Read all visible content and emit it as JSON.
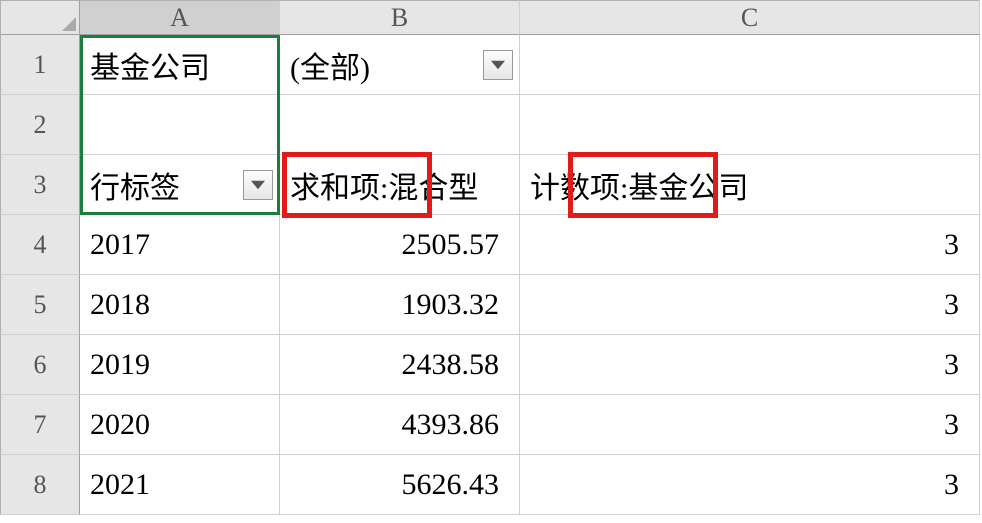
{
  "columns": [
    "A",
    "B",
    "C"
  ],
  "rows": [
    "1",
    "2",
    "3",
    "4",
    "5",
    "6",
    "7",
    "8"
  ],
  "a1_label": "基金公司",
  "b1_filter_value": "(全部)",
  "a3_label": "行标签",
  "b3_label": "求和项:混合型",
  "c3_label": "计数项:基金公司",
  "data_rows": [
    {
      "year": "2017",
      "sum": "2505.57",
      "count": "3"
    },
    {
      "year": "2018",
      "sum": "1903.32",
      "count": "3"
    },
    {
      "year": "2019",
      "sum": "2438.58",
      "count": "3"
    },
    {
      "year": "2020",
      "sum": "4393.86",
      "count": "3"
    },
    {
      "year": "2021",
      "sum": "5626.43",
      "count": "3"
    }
  ]
}
